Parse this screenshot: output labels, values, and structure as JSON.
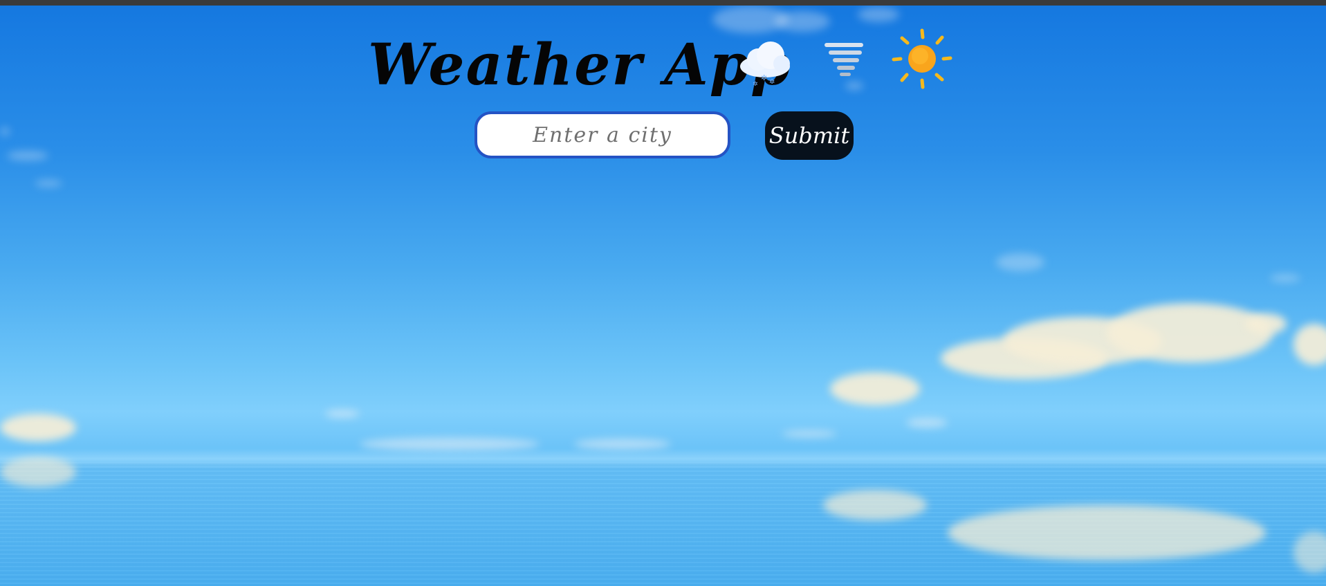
{
  "header": {
    "title": "Weather App",
    "icons": [
      "snow-cloud-icon",
      "wind-icon",
      "sun-icon"
    ]
  },
  "search": {
    "value": "",
    "placeholder": "Enter a city",
    "submit_label": "Submit"
  },
  "colors": {
    "sky_top": "#1578e0",
    "sky_mid": "#6cc4f8",
    "input_border": "#2453c4",
    "button_bg": "#07111c",
    "sun": "#f7b21f"
  }
}
